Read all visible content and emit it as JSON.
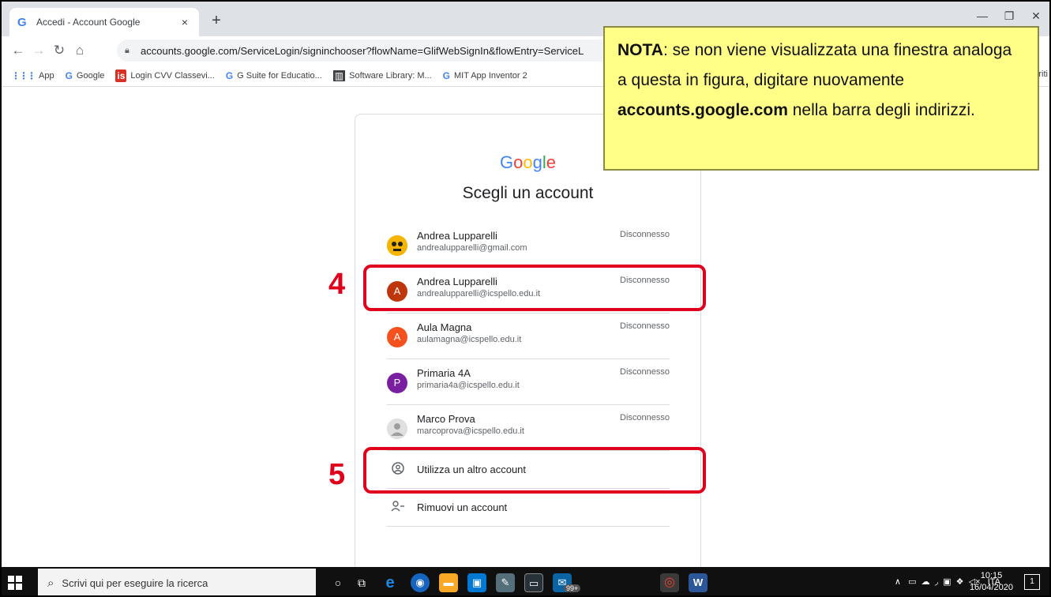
{
  "browser": {
    "tab_title": "Accedi - Account Google",
    "tab_close": "×",
    "new_tab": "+",
    "url": "accounts.google.com/ServiceLogin/signinchooser?flowName=GlifWebSignIn&flowEntry=ServiceL",
    "bookmarks": [
      {
        "label": "App",
        "icon": "apps-grid-icon"
      },
      {
        "label": "Google",
        "icon": "google-g-icon"
      },
      {
        "label": "Login CVV Classevi...",
        "icon": "classeviva-icon"
      },
      {
        "label": "G Suite for Educatio...",
        "icon": "google-g-icon"
      },
      {
        "label": "Software Library: M...",
        "icon": "library-icon"
      },
      {
        "label": "MIT App Inventor 2",
        "icon": "google-g-icon"
      }
    ],
    "bookmarks_overflow": "riti"
  },
  "signin": {
    "logo": [
      "G",
      "o",
      "o",
      "g",
      "l",
      "e"
    ],
    "title": "Scegli un account",
    "accounts": [
      {
        "name": "Andrea Lupparelli",
        "email": "andrealupparelli@gmail.com",
        "status": "Disconnesso",
        "avatar": "",
        "avatar_color": "#f4b400"
      },
      {
        "name": "Andrea Lupparelli",
        "email": "andrealupparelli@icspello.edu.it",
        "status": "Disconnesso",
        "avatar": "A",
        "avatar_color": "#bf360c"
      },
      {
        "name": "Aula Magna",
        "email": "aulamagna@icspello.edu.it",
        "status": "Disconnesso",
        "avatar": "A",
        "avatar_color": "#f4511e"
      },
      {
        "name": "Primaria 4A",
        "email": "primaria4a@icspello.edu.it",
        "status": "Disconnesso",
        "avatar": "P",
        "avatar_color": "#7b1fa2"
      },
      {
        "name": "Marco Prova",
        "email": "marcoprova@icspello.edu.it",
        "status": "Disconnesso",
        "avatar": "",
        "avatar_color": "#e0e0e0"
      }
    ],
    "use_other": "Utilizza un altro account",
    "remove": "Rimuovi un account"
  },
  "annotations": {
    "step4": "4",
    "step5": "5",
    "note_bold1": "NOTA",
    "note_text1": ": se non viene visualizzata una finestra analoga a questa in figura, digitare nuovamente ",
    "note_bold2": "accounts.google.com",
    "note_text2": " nella barra degli indirizzi."
  },
  "taskbar": {
    "search_placeholder": "Scrivi qui per eseguire la ricerca",
    "badge": "99+",
    "lang": "ITA",
    "time": "10:15",
    "date": "16/04/2020",
    "notif": "1"
  },
  "colors": {
    "annotation_red": "#e0001b",
    "note_yellow": "#ffff88"
  }
}
